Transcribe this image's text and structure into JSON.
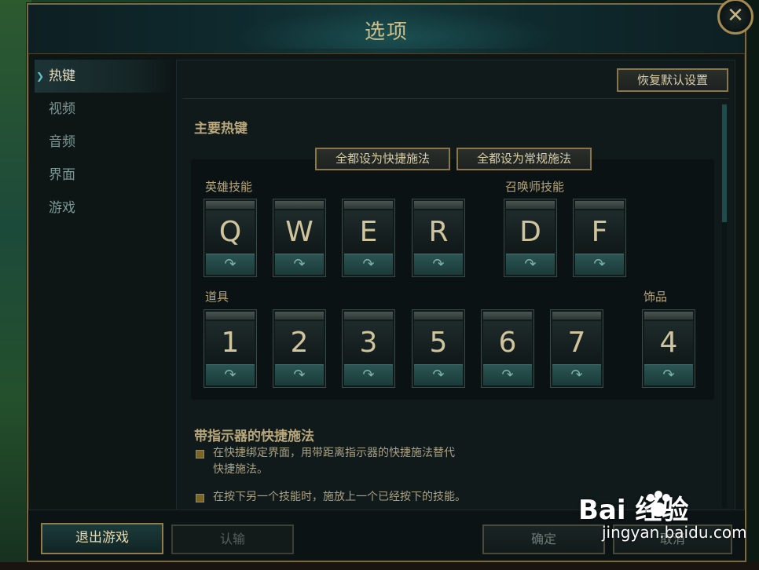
{
  "window": {
    "title": "选项",
    "close_glyph": "✕"
  },
  "sidebar": {
    "items": [
      {
        "label": "热键",
        "active": true
      },
      {
        "label": "视频",
        "active": false
      },
      {
        "label": "音频",
        "active": false
      },
      {
        "label": "界面",
        "active": false
      },
      {
        "label": "游戏",
        "active": false
      }
    ]
  },
  "panel": {
    "restore_defaults": "恢复默认设置",
    "main_hotkeys": {
      "title": "主要热键",
      "set_all_quick": "全都设为快捷施法",
      "set_all_normal": "全都设为常规施法",
      "champion_abilities_label": "英雄技能",
      "summoner_spells_label": "召唤师技能",
      "items_label": "道具",
      "trinket_label": "饰品",
      "champion_keys": [
        "Q",
        "W",
        "E",
        "R"
      ],
      "summoner_keys": [
        "D",
        "F"
      ],
      "item_keys": [
        "1",
        "2",
        "3",
        "5",
        "6",
        "7"
      ],
      "trinket_key": "4",
      "cast_icon": "quick-cast-arrow-icon",
      "cast_glyph": "↷"
    },
    "indicator_section": {
      "title": "带指示器的快捷施法",
      "option1_line1": "在快捷绑定界面，用带距离指示器的快捷施法替代",
      "option1_line2": "快捷施法。",
      "option2": "在按下另一个技能时，施放上一个已经按下的技能。"
    }
  },
  "footer": {
    "exit_game": "退出游戏",
    "surrender": "认输",
    "ok": "确定",
    "cancel": "取消"
  },
  "watermark": {
    "main": "Bai  经验",
    "sub": "jingyan.baidu.com"
  },
  "colors": {
    "gold_text": "#b8a77a",
    "accent_teal": "#66c6cf",
    "border_gold": "#8b7647"
  }
}
